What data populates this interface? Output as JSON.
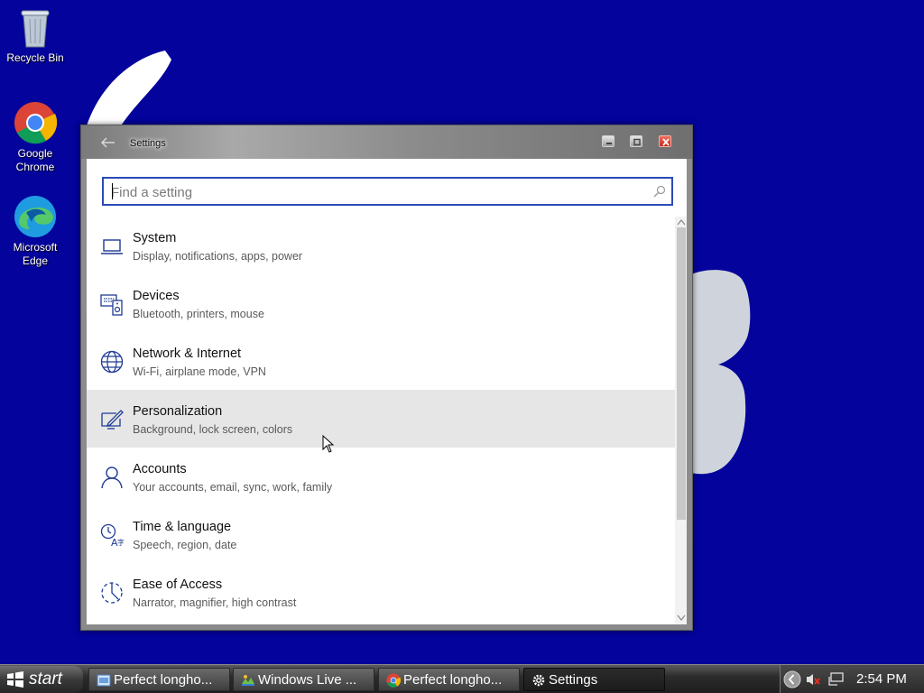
{
  "desktop": {
    "icons": [
      {
        "label": "Recycle Bin"
      },
      {
        "label": "Google Chrome"
      },
      {
        "label": "Microsoft Edge"
      }
    ]
  },
  "window": {
    "title": "Settings",
    "search": {
      "placeholder": "Find a setting",
      "value": ""
    },
    "items": [
      {
        "name": "System",
        "desc": "Display, notifications, apps, power",
        "icon": "laptop-icon"
      },
      {
        "name": "Devices",
        "desc": "Bluetooth, printers, mouse",
        "icon": "devices-icon"
      },
      {
        "name": "Network & Internet",
        "desc": "Wi-Fi, airplane mode, VPN",
        "icon": "globe-icon"
      },
      {
        "name": "Personalization",
        "desc": "Background, lock screen, colors",
        "icon": "personalization-icon"
      },
      {
        "name": "Accounts",
        "desc": "Your accounts, email, sync, work, family",
        "icon": "person-icon"
      },
      {
        "name": "Time & language",
        "desc": "Speech, region, date",
        "icon": "time-language-icon"
      },
      {
        "name": "Ease of Access",
        "desc": "Narrator, magnifier, high contrast",
        "icon": "ease-of-access-icon"
      }
    ],
    "hovered_item": "Personalization"
  },
  "taskbar": {
    "start_label": "start",
    "buttons": [
      {
        "label": "Perfect longho...",
        "icon": "document-icon"
      },
      {
        "label": "Windows Live ...",
        "icon": "photo-gallery-icon"
      },
      {
        "label": "Perfect longho...",
        "icon": "chrome-icon"
      },
      {
        "label": "Settings",
        "icon": "gear-icon",
        "active": true
      }
    ],
    "clock": "2:54 PM"
  },
  "colors": {
    "desktop_bg": "#04039b",
    "accent": "#2a4bb3",
    "icon_blue": "#1f3a93"
  }
}
